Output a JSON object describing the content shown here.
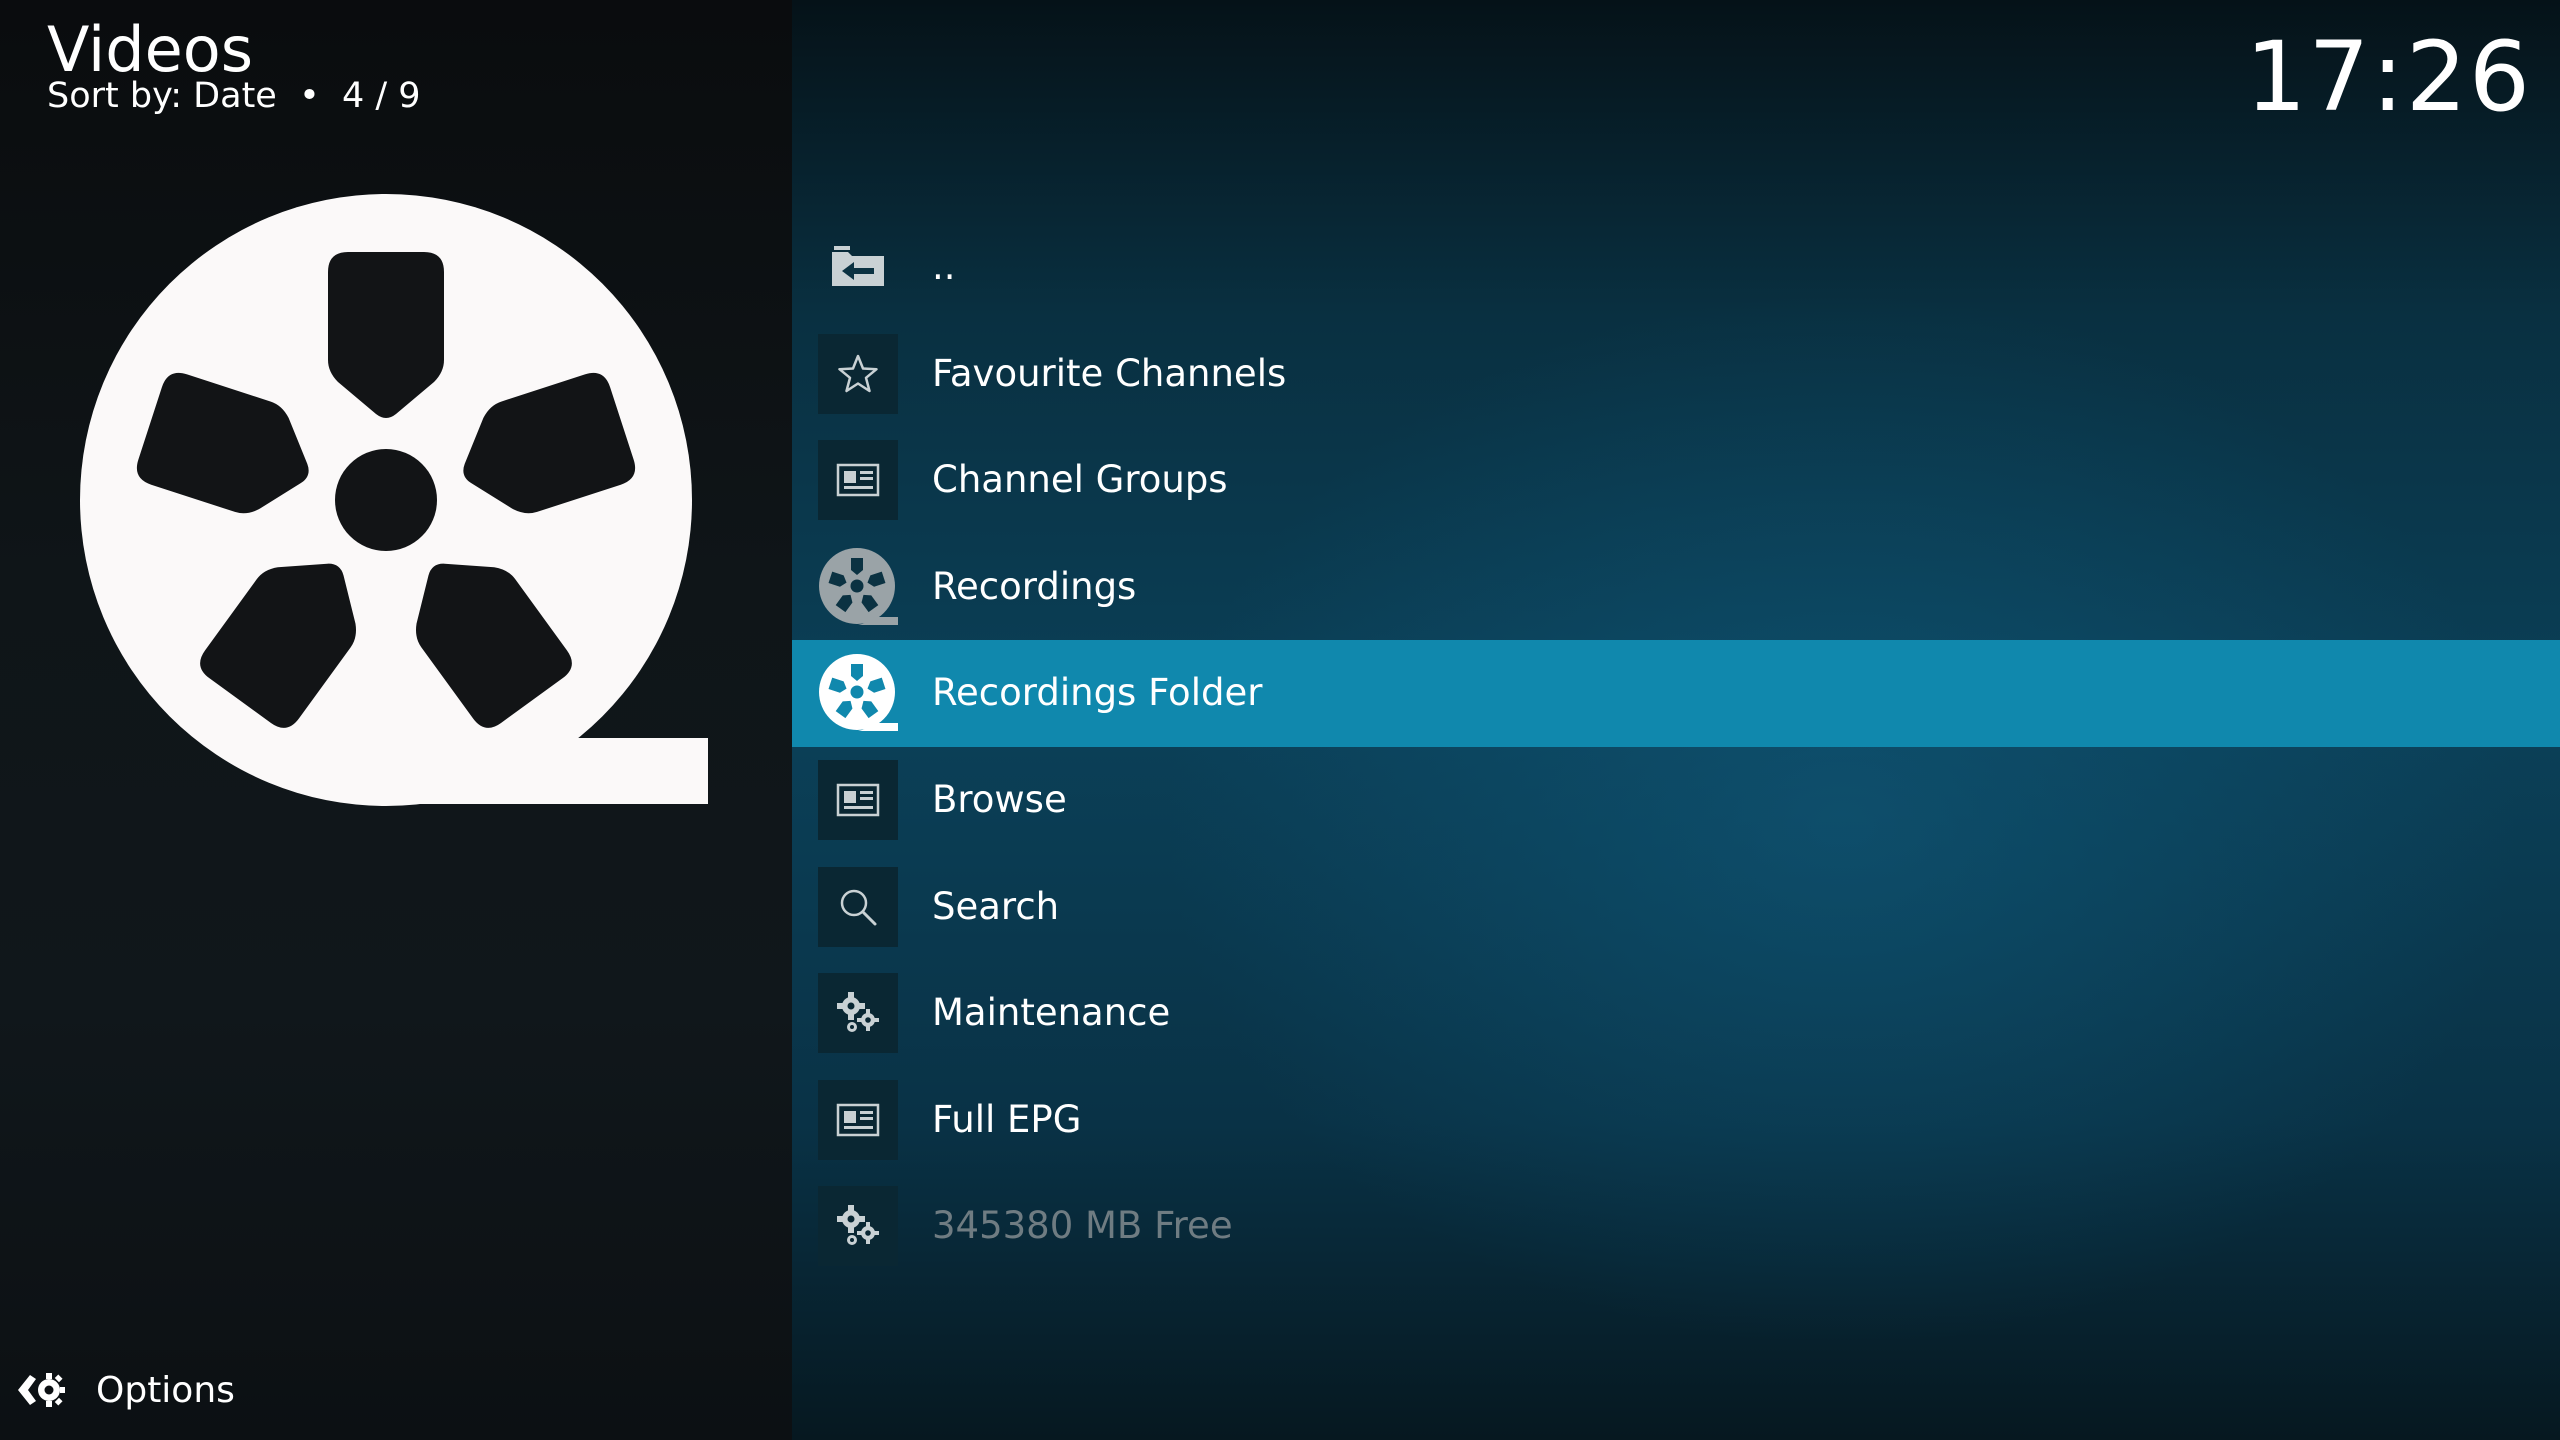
{
  "header": {
    "title": "Videos",
    "subtitle": "Sort by: Date  •  4 / 9"
  },
  "clock": "17:26",
  "footer": {
    "options_label": "Options"
  },
  "list": [
    {
      "label": "..",
      "icon": "folder-back-icon"
    },
    {
      "label": "Favourite Channels",
      "icon": "star-icon"
    },
    {
      "label": "Channel Groups",
      "icon": "list-view-icon"
    },
    {
      "label": "Recordings",
      "icon": "film-reel-icon"
    },
    {
      "label": "Recordings Folder",
      "icon": "film-reel-icon",
      "selected": true
    },
    {
      "label": "Browse",
      "icon": "list-view-icon"
    },
    {
      "label": "Search",
      "icon": "search-icon"
    },
    {
      "label": "Maintenance",
      "icon": "gears-icon"
    },
    {
      "label": "Full EPG",
      "icon": "list-view-icon"
    },
    {
      "label": "345380 MB Free",
      "icon": "gears-icon",
      "dimmed": true
    }
  ],
  "colors": {
    "selection": "#1088ad",
    "icon_tile": "#0a2733",
    "dimmed_text": "#6f7c82"
  }
}
